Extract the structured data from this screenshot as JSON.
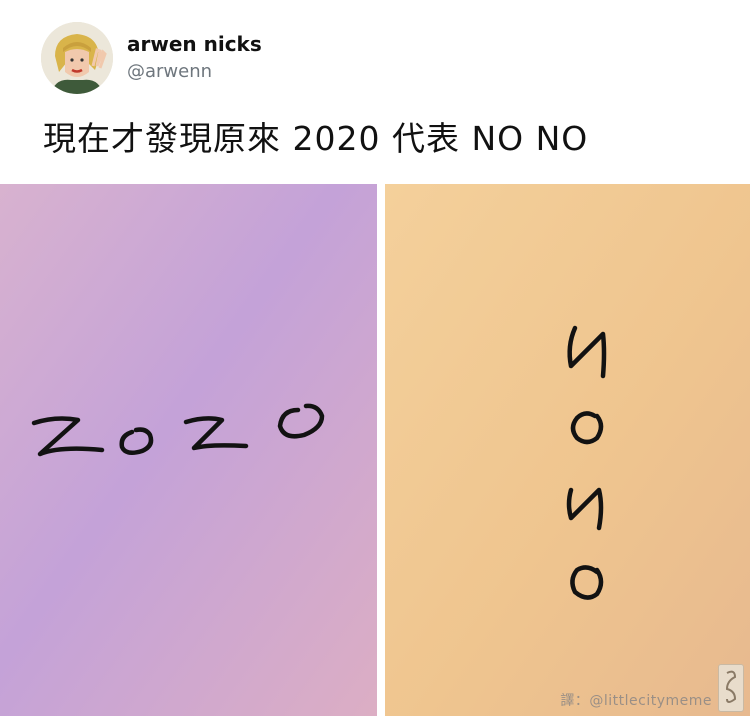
{
  "user": {
    "display_name": "arwen nicks",
    "handle": "@arwenn"
  },
  "tweet": {
    "text": "現在才發現原來 2020 代表 NO NO"
  },
  "photos": [
    {
      "handwriting": "2020",
      "background": "#c7a7d9"
    },
    {
      "handwriting": "2020",
      "background": "#f0c796"
    }
  ],
  "watermark": {
    "text": "譯：@littlecitymeme"
  },
  "colors": {
    "ink": "#121212",
    "handle_gray": "#6e767d"
  }
}
